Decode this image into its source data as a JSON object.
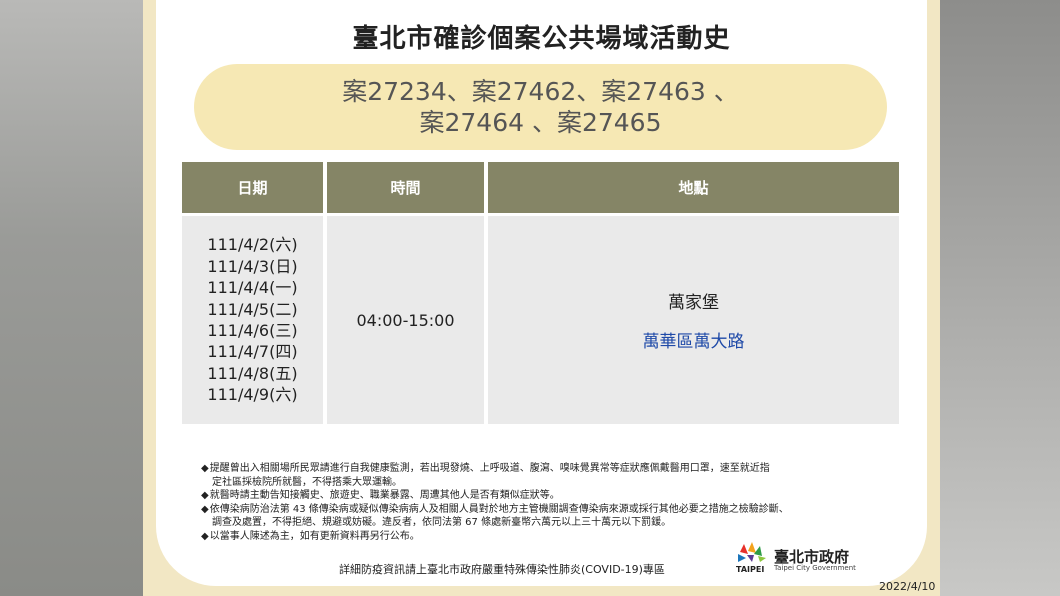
{
  "title": "臺北市確診個案公共場域活動史",
  "cases": {
    "line1": "案27234、案27462、案27463 、",
    "line2": "案27464 、案27465"
  },
  "table": {
    "headers": [
      "日期",
      "時間",
      "地點"
    ],
    "dates": [
      "111/4/2(六)",
      "111/4/3(日)",
      "111/4/4(一)",
      "111/4/5(二)",
      "111/4/6(三)",
      "111/4/7(四)",
      "111/4/8(五)",
      "111/4/9(六)"
    ],
    "time": "04:00-15:00",
    "place_name": "萬家堡",
    "place_address": "萬華區萬大路"
  },
  "notes": [
    {
      "bullet": "◆",
      "text": "提醒曾出入相關場所民眾請進行自我健康監測，若出現發燒、上呼吸道、腹瀉、嗅味覺異常等症狀應佩戴醫用口罩，速至就近指"
    },
    {
      "bullet": "",
      "text": "定社區採檢院所就醫，不得搭乘大眾運輸。"
    },
    {
      "bullet": "◆",
      "text": "就醫時請主動告知接觸史、旅遊史、職業暴露、周遭其他人是否有類似症狀等。"
    },
    {
      "bullet": "◆",
      "text": "依傳染病防治法第 43 條傳染病或疑似傳染病病人及相關人員對於地方主管機關調查傳染病來源或採行其他必要之措施之檢驗診斷、"
    },
    {
      "bullet": "",
      "text": "調查及處置，不得拒絕、規避或妨礙。違反者，依同法第 67 條處新臺幣六萬元以上三十萬元以下罰鍰。"
    },
    {
      "bullet": "◆",
      "text": "以當事人陳述為主，如有更新資料再另行公布。"
    }
  ],
  "footer": "詳細防疫資訊請上臺北市政府嚴重特殊傳染性肺炎(COVID-19)專區",
  "logo": {
    "taipei": "TAIPEI",
    "name_cn": "臺北市政府",
    "name_en": "Taipei City Government"
  },
  "date_stamp": "2022/4/10",
  "colors": {
    "header_bg": "#858566",
    "pill_bg": "#f6e8b4",
    "frame_bg": "#f2e7c4",
    "address_text": "#1f4aa8"
  }
}
